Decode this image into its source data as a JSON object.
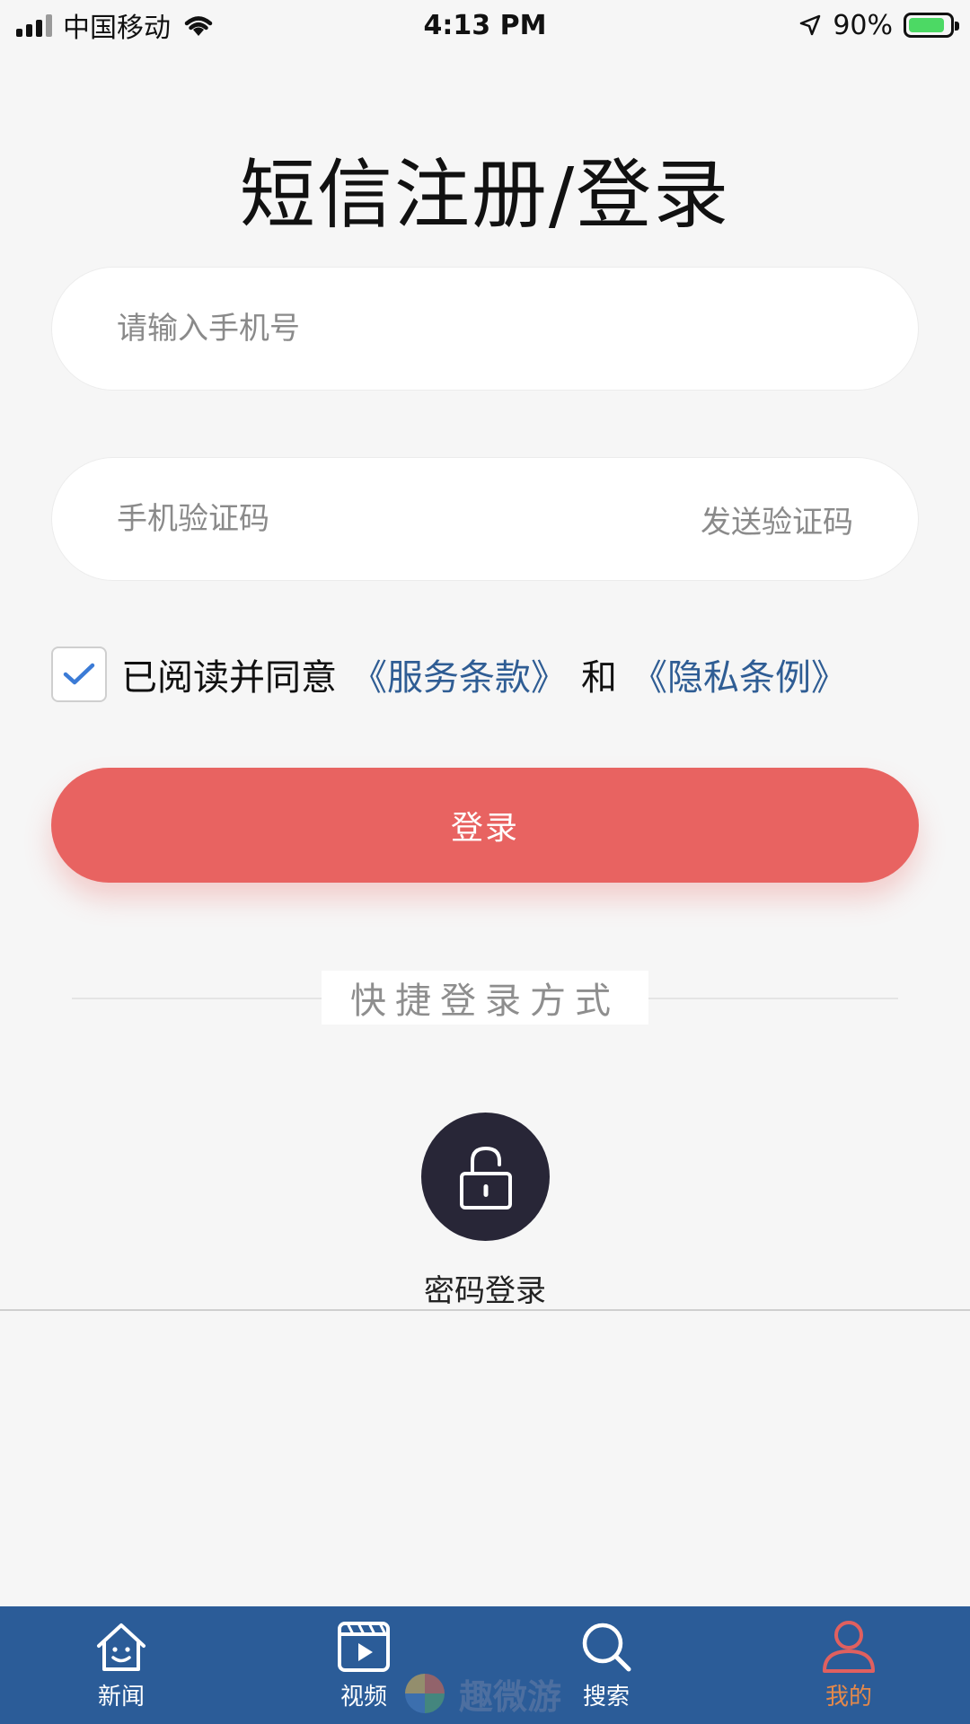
{
  "status_bar": {
    "carrier": "中国移动",
    "time": "4:13 PM",
    "battery": "90%",
    "battery_level": 0.9
  },
  "title": "短信注册/登录",
  "phone_input": {
    "placeholder": "请输入手机号",
    "value": ""
  },
  "code_input": {
    "placeholder": "手机验证码",
    "value": "",
    "send_label": "发送验证码"
  },
  "agreement": {
    "checked": true,
    "prefix": "已阅读并同意",
    "terms_link": "《服务条款》",
    "joiner": "和",
    "privacy_link": "《隐私条例》"
  },
  "login_button": "登录",
  "quick_login": {
    "divider_label": "快捷登录方式",
    "password_login_label": "密码登录"
  },
  "tab_bar": {
    "items": [
      {
        "label": "新闻",
        "icon": "house-icon",
        "active": false
      },
      {
        "label": "视频",
        "icon": "video-icon",
        "active": false
      },
      {
        "label": "搜索",
        "icon": "search-icon",
        "active": false
      },
      {
        "label": "我的",
        "icon": "user-icon",
        "active": true
      }
    ]
  },
  "watermark": {
    "text": "趣微游"
  },
  "colors": {
    "accent_button": "#e86361",
    "tab_bar": "#2b5c98",
    "link": "#2f5d94",
    "active_tab": "#e5894a",
    "lock_circle": "#282637"
  }
}
